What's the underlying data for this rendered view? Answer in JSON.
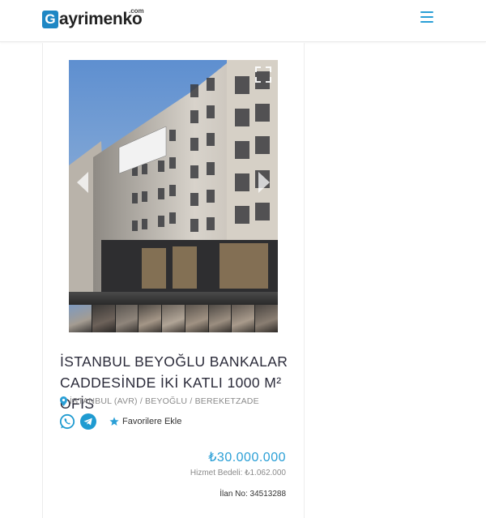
{
  "header": {
    "logo_letter": "G",
    "logo_text": "ayrimenko",
    "logo_suffix": ".com",
    "menu_icon": "hamburger-icon"
  },
  "gallery": {
    "expand_icon": "expand-icon",
    "prev_icon": "chevron-left-icon",
    "next_icon": "chevron-right-icon",
    "thumbnail_count": 9
  },
  "listing": {
    "title": "İSTANBUL BEYOĞLU BANKALAR CADDESİNDE İKİ KATLI 1000 M² OFİS",
    "location": "İSTANBUL (AVR) / BEYOĞLU / BEREKETZADE",
    "favorite_label": "Favorilere Ekle",
    "price": "₺30.000.000",
    "service_fee": "Hizmet Bedeli: ₺1.062.000",
    "listing_no": "İlan No: 34513288"
  },
  "colors": {
    "accent": "#2a9fd6",
    "logo_blue": "#1f87c4",
    "whatsapp": "#1f9bd1",
    "telegram": "#1f9bd1"
  }
}
